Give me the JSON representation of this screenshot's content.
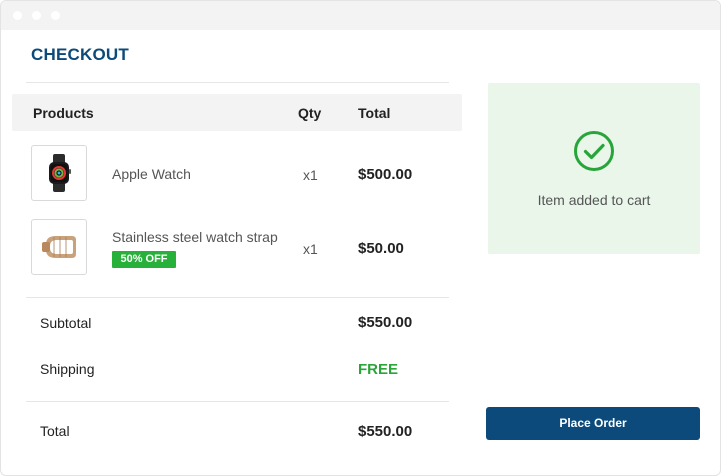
{
  "page": {
    "title": "CHECKOUT"
  },
  "table": {
    "headers": {
      "products": "Products",
      "qty": "Qty",
      "total": "Total"
    },
    "items": [
      {
        "name": "Apple Watch",
        "qty": "x1",
        "total": "$500.00",
        "icon": "apple-watch-icon"
      },
      {
        "name": "Stainless steel watch strap",
        "qty": "x1",
        "total": "$50.00",
        "badge": "50% OFF",
        "icon": "watch-strap-icon"
      }
    ]
  },
  "summary": {
    "subtotal_label": "Subtotal",
    "subtotal_value": "$550.00",
    "shipping_label": "Shipping",
    "shipping_value": "FREE",
    "total_label": "Total",
    "total_value": "$550.00"
  },
  "notice": {
    "text": "Item added to cart",
    "icon": "check-circle-icon"
  },
  "actions": {
    "place_order_label": "Place Order"
  },
  "colors": {
    "brand": "#0b4a7a",
    "success": "#2aa53a",
    "badge": "#28b13a",
    "notice_bg": "#e9f6e9"
  }
}
